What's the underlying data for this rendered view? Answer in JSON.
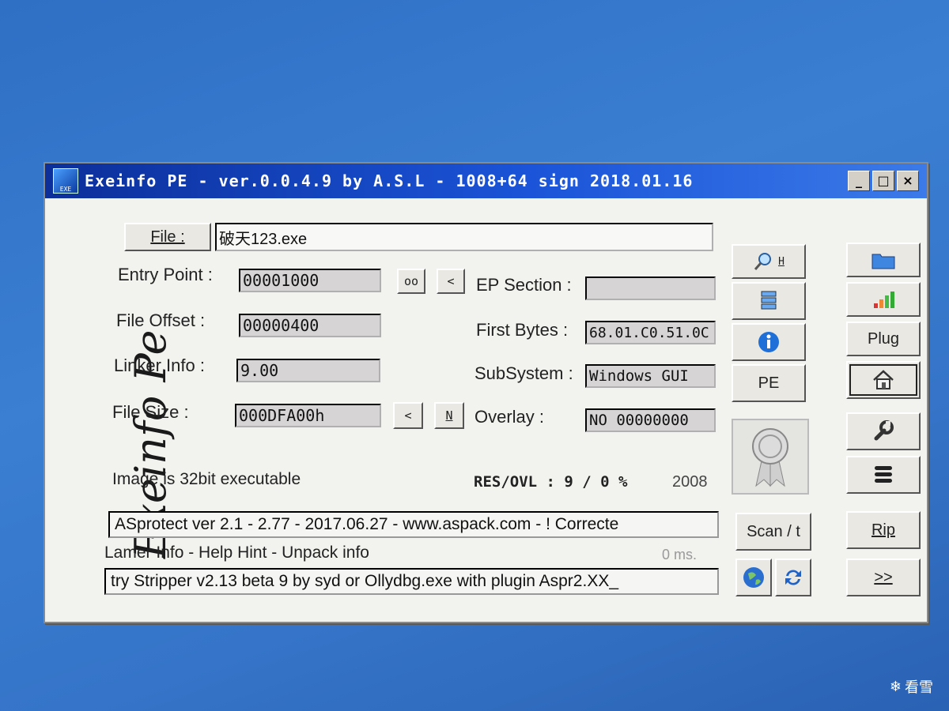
{
  "window": {
    "title": "Exeinfo PE - ver.0.0.4.9  by A.S.L -  1008+64 sign  2018.01.16",
    "icon_label": "EXE",
    "controls": {
      "minimize": "_",
      "maximize": "□",
      "close": "×"
    }
  },
  "signature": "Exeinfo Pe",
  "file": {
    "button_label": "File :",
    "value": "破天123.exe"
  },
  "fields": {
    "entry_point": {
      "label": "Entry Point :",
      "value": "00001000"
    },
    "file_offset": {
      "label": "File Offset :",
      "value": "00000400"
    },
    "linker_info": {
      "label": "Linker Info :",
      "value": "9.00"
    },
    "file_size": {
      "label": "File Size :",
      "value": "000DFA00h"
    },
    "ep_section": {
      "label": "EP Section :",
      "value": ""
    },
    "first_bytes": {
      "label": "First Bytes :",
      "value": "68.01.C0.51.0C"
    },
    "subsystem": {
      "label": "SubSystem :",
      "value": "Windows GUI"
    },
    "overlay": {
      "label": "Overlay :",
      "value": "NO  00000000"
    }
  },
  "small_buttons": {
    "oo": "oo",
    "lt1": "<",
    "lt2": "<",
    "n": "N"
  },
  "image_info": "Image is 32bit executable",
  "res_ovl": "RES/OVL : 9 / 0 %",
  "year": "2008",
  "detection": "ASprotect ver 2.1 - 2.77 - 2017.06.27 - www.aspack.com - ! Correcte",
  "lamer_info": "Lamer Info - Help Hint - Unpack info",
  "timing": "0 ms.",
  "hint": "try Stripper v2.13 beta 9 by syd or Ollydbg.exe with plugin Aspr2.XX_",
  "buttons": {
    "search_h": "H",
    "pe": "PE",
    "scan": "Scan / t",
    "plug": "Plug",
    "rip": "Rip",
    "more": ">>"
  },
  "watermark": "看雪"
}
